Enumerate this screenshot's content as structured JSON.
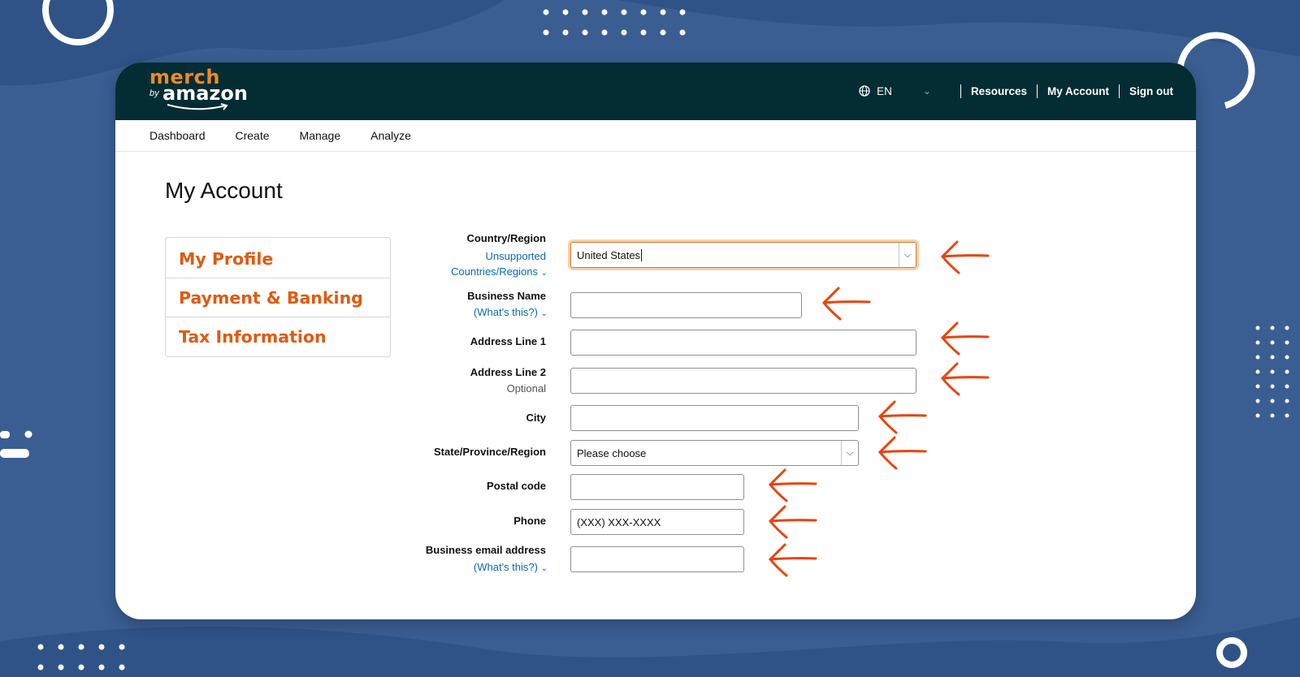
{
  "brand": {
    "merch": "merch",
    "by": "by",
    "amazon": "amazon"
  },
  "header": {
    "language": "EN",
    "links": [
      "Resources",
      "My Account",
      "Sign out"
    ]
  },
  "subnav": [
    "Dashboard",
    "Create",
    "Manage",
    "Analyze"
  ],
  "page_title": "My Account",
  "sidebar": [
    "My Profile",
    "Payment & Banking",
    "Tax Information"
  ],
  "form": {
    "country": {
      "label": "Country/Region",
      "link1": "Unsupported",
      "link2": "Countries/Regions",
      "value": "United States"
    },
    "business_name": {
      "label": "Business Name",
      "link": "(What's this?)",
      "value": ""
    },
    "address1": {
      "label": "Address Line 1",
      "value": ""
    },
    "address2": {
      "label": "Address Line 2",
      "note": "Optional",
      "value": ""
    },
    "city": {
      "label": "City",
      "value": ""
    },
    "state": {
      "label": "State/Province/Region",
      "value": "Please choose"
    },
    "postal": {
      "label": "Postal code",
      "value": ""
    },
    "phone": {
      "label": "Phone",
      "placeholder": "(XXX) XXX-XXXX"
    },
    "email": {
      "label": "Business email address",
      "link": "(What's this?)",
      "value": ""
    }
  },
  "colors": {
    "background": "#3a5e92",
    "topbar": "#032c33",
    "accent_orange": "#e05a10",
    "link_blue": "#0a6ab4",
    "annotation_arrow": "#e8440f"
  },
  "icons": [
    "globe-icon",
    "chevron-down-icon",
    "annotation-arrow-icon"
  ]
}
